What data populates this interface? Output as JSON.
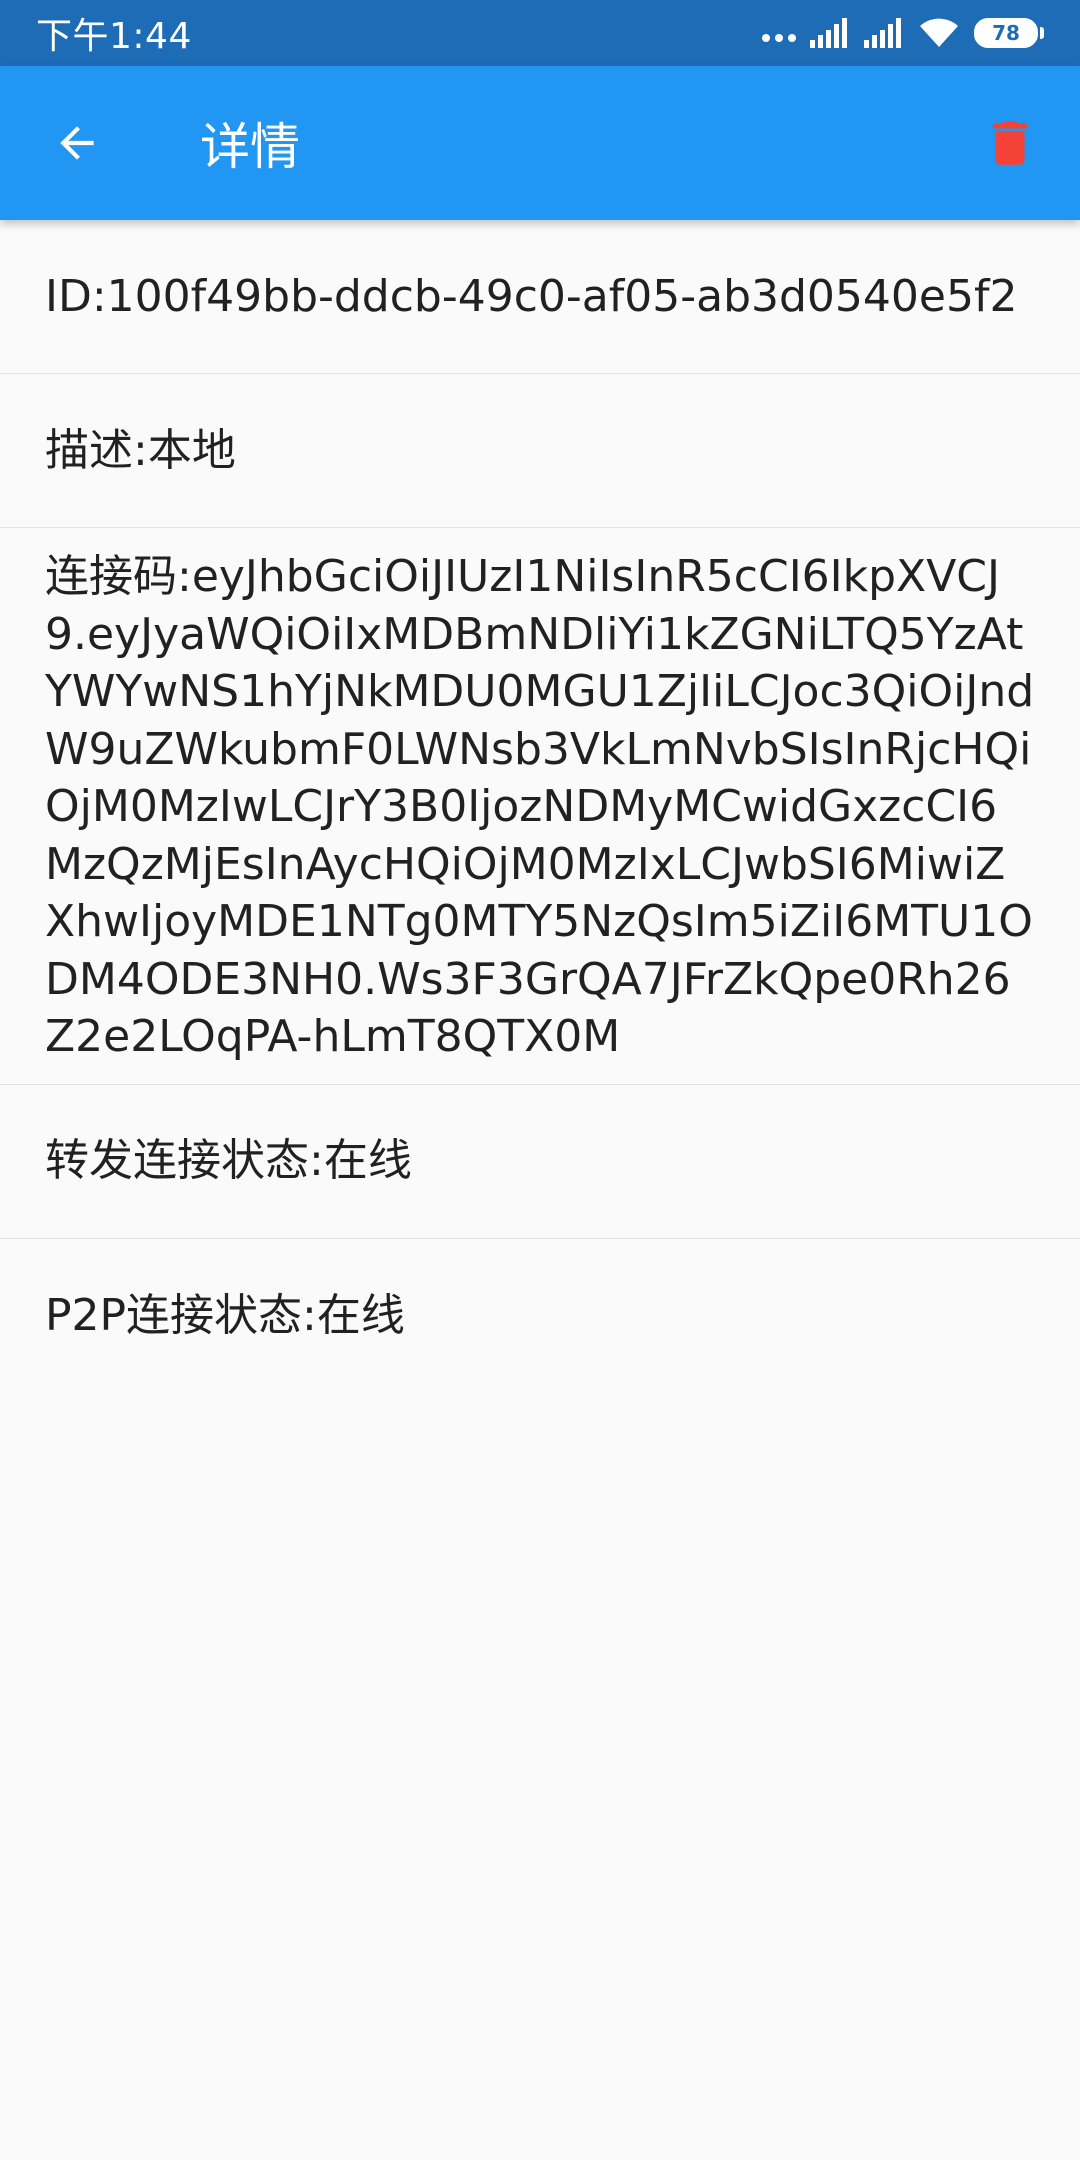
{
  "status_bar": {
    "time": "下午1:44",
    "battery": "78",
    "icons": [
      "more-dots-icon",
      "signal-icon",
      "signal-icon",
      "wifi-icon",
      "battery-icon"
    ]
  },
  "app_bar": {
    "title": "详情",
    "back_icon": "arrow-back-icon",
    "delete_icon": "trash-icon",
    "colors": {
      "background": "#2196f3",
      "status_background": "#1e6cb5",
      "delete": "#f44336"
    }
  },
  "details": {
    "id": "ID:100f49bb-ddcb-49c0-af05-ab3d0540e5f2",
    "description": "描述:本地",
    "token": "连接码:eyJhbGciOiJIUzI1NiIsInR5cCI6IkpXVCJ9.eyJyaWQiOiIxMDBmNDliYi1kZGNiLTQ5YzAtYWYwNS1hYjNkMDU0MGU1ZjIiLCJoc3QiOiJndW9uZWkubmF0LWNsb3VkLmNvbSIsInRjcHQiOjM0MzIwLCJrY3B0IjozNDMyMCwidGxzcCI6MzQzMjEsInAycHQiOjM0MzIxLCJwbSI6MiwiZXhwIjoyMDE1NTg0MTY5NzQsIm5iZiI6MTU1ODM4ODE3NH0.Ws3F3GrQA7JFrZkQpe0Rh26Z2e2LOqPA-hLmT8QTX0M",
    "relay_status": "转发连接状态:在线",
    "p2p_status": "P2P连接状态:在线"
  }
}
